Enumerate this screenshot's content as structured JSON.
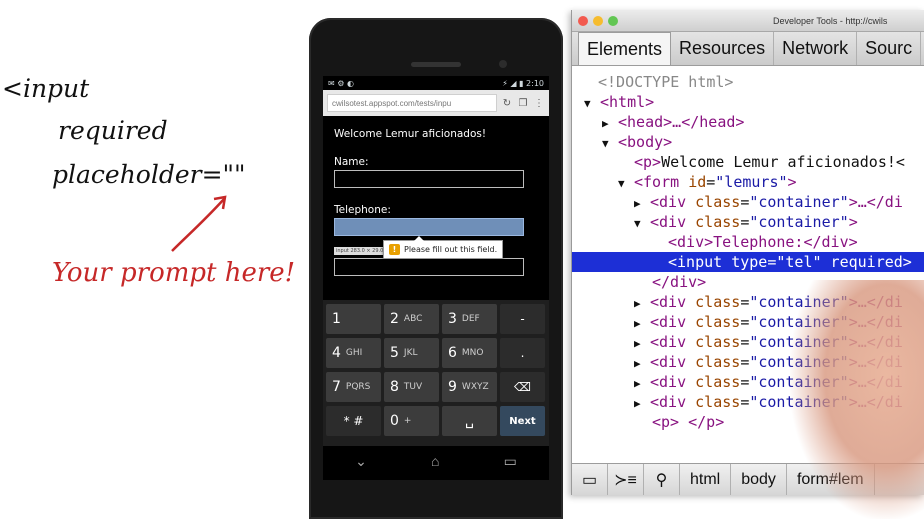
{
  "notes": {
    "line1": "<input",
    "line2": "required",
    "line3": "placeholder=\"\"",
    "prompt": "Your prompt here!"
  },
  "phone": {
    "status_time": "2:10",
    "url": "cwilsotest.appspot.com/tests/inpu",
    "page": {
      "welcome": "Welcome Lemur aficionados!",
      "name_label": "Name:",
      "telephone_label": "Telephone:",
      "tooltip": "Please fill out this field.",
      "hint": "input 283.0 × 29.0"
    },
    "keyboard": [
      {
        "main": "1",
        "sub": ""
      },
      {
        "main": "2",
        "sub": "ABC"
      },
      {
        "main": "3",
        "sub": "DEF"
      },
      {
        "main": "-",
        "sub": "",
        "fn": true
      },
      {
        "main": "4",
        "sub": "GHI"
      },
      {
        "main": "5",
        "sub": "JKL"
      },
      {
        "main": "6",
        "sub": "MNO"
      },
      {
        "main": ".",
        "sub": "",
        "fn": true
      },
      {
        "main": "7",
        "sub": "PQRS"
      },
      {
        "main": "8",
        "sub": "TUV"
      },
      {
        "main": "9",
        "sub": "WXYZ"
      },
      {
        "main": "⌫",
        "sub": "",
        "fn": true
      },
      {
        "main": "* #",
        "sub": "",
        "fn": true
      },
      {
        "main": "0",
        "sub": "+"
      },
      {
        "main": "␣",
        "sub": "",
        "space": true
      },
      {
        "main": "Next",
        "sub": "",
        "next": true
      }
    ]
  },
  "devtools": {
    "title": "Developer Tools - http://cwils",
    "tabs": [
      "Elements",
      "Resources",
      "Network",
      "Sourc"
    ],
    "active_tab": "Elements",
    "tree": {
      "doctype": "<!DOCTYPE html>",
      "html_open": "<html>",
      "head": "<head>…</head>",
      "body_open": "<body>",
      "p_text": "Welcome Lemur aficionados!<",
      "form_tag": "form",
      "form_attr": "id",
      "form_val": "\"lemurs\"",
      "div_tag": "div",
      "class_attr": "class",
      "container_val": "\"container\"",
      "collapsed_suffix": ">…</di",
      "telephone_div": "<div>Telephone:</div>",
      "input_selected": "<input type=\"tel\" required>",
      "div_close": "</div>",
      "p_empty": "<p> </p>"
    },
    "bottom": [
      "html",
      "body",
      "form#lem"
    ]
  }
}
